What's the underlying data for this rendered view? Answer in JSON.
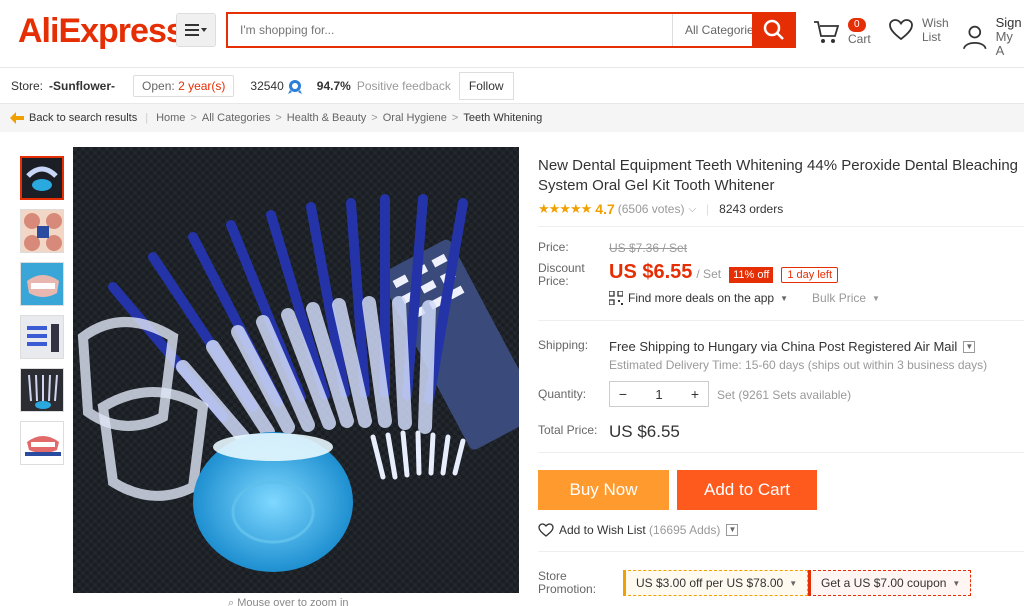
{
  "header": {
    "logo": "AliExpress",
    "search_placeholder": "I'm shopping for...",
    "category": "All Categories",
    "cart_count": "0",
    "cart_label": "Cart",
    "wish_line1": "Wish",
    "wish_line2": "List",
    "sign_line1": "Sign",
    "sign_line2": "My A"
  },
  "store": {
    "label": "Store:",
    "name": "-Sunflower-",
    "open_prefix": "Open:",
    "open_years": "2 year(s)",
    "score": "32540",
    "positive_pct": "94.7%",
    "positive_label": "Positive feedback",
    "follow": "Follow"
  },
  "breadcrumb": {
    "back": "Back to search results",
    "items": [
      "Home",
      "All Categories",
      "Health & Beauty",
      "Oral Hygiene"
    ],
    "current": "Teeth Whitening"
  },
  "gallery": {
    "zoom_hint": "Mouse over to zoom in"
  },
  "product": {
    "title": "New Dental Equipment Teeth Whitening 44% Peroxide Dental Bleaching System Oral Gel Kit Tooth Whitener",
    "stars": "★★★★★",
    "rating": "4.7",
    "votes": "(6506 votes)",
    "orders": "8243 orders",
    "price_label": "Price:",
    "old_price": "US $7.36 / Set",
    "discount_label_1": "Discount",
    "discount_label_2": "Price:",
    "price": "US $6.55",
    "unit": "/ Set",
    "off": "11% off",
    "day_left": "1 day left",
    "deals": "Find more deals on the app",
    "bulk": "Bulk Price",
    "shipping_label": "Shipping:",
    "shipping_free": "Free Shipping",
    "shipping_rest": "to Hungary via China Post Registered Air Mail",
    "estimated": "Estimated Delivery Time: 15-60 days (ships out within 3 business days)",
    "quantity_label": "Quantity:",
    "quantity": "1",
    "available": "Set (9261 Sets available)",
    "total_label": "Total Price:",
    "total": "US $6.55",
    "buy_now": "Buy Now",
    "add_to_cart": "Add to Cart",
    "wish_text": "Add to Wish List",
    "wish_count": "(16695 Adds)",
    "promo_label_1": "Store",
    "promo_label_2": "Promotion:",
    "promo1": "US $3.00 off per US $78.00",
    "promo2": "Get a US $7.00 coupon"
  },
  "colors": {
    "brand": "#e62e04",
    "buy": "#ff9a2e",
    "cart": "#ff5a1e",
    "star": "#f0a000"
  }
}
